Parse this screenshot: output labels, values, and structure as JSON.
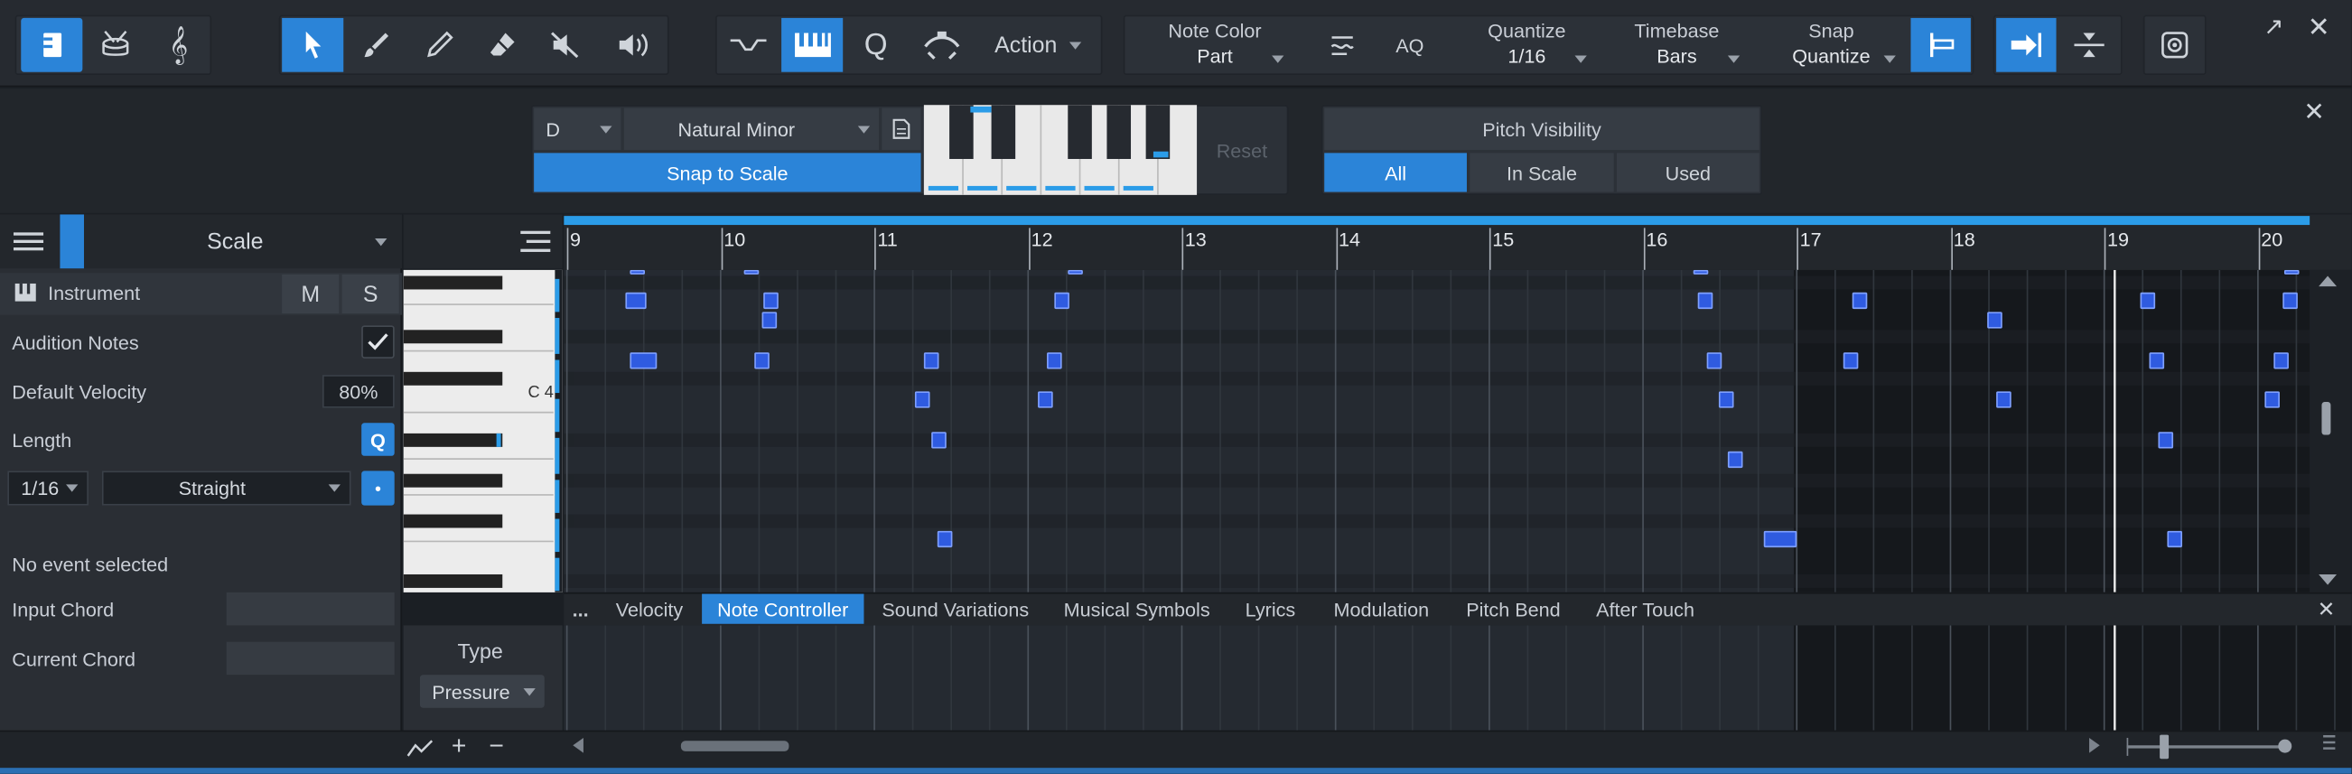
{
  "toolbar": {
    "note_color_label": "Note Color",
    "note_color_value": "Part",
    "aq_label": "AQ",
    "quantize_label": "Quantize",
    "quantize_value": "1/16",
    "timebase_label": "Timebase",
    "timebase_value": "Bars",
    "snap_label": "Snap",
    "snap_value": "Quantize",
    "action_label": "Action"
  },
  "scale_bar": {
    "root": "D",
    "scale": "Natural Minor",
    "snap_to_scale": "Snap to Scale",
    "reset": "Reset",
    "pitch_visibility": "Pitch Visibility",
    "pv_all": "All",
    "pv_in_scale": "In Scale",
    "pv_used": "Used"
  },
  "inspector": {
    "header": "Scale",
    "instrument": "Instrument",
    "m": "M",
    "s": "S",
    "audition_notes": "Audition Notes",
    "default_velocity": "Default Velocity",
    "velocity_value": "80%",
    "length": "Length",
    "q": "Q",
    "length_value": "1/16",
    "length_mode": "Straight",
    "no_event": "No event selected",
    "input_chord": "Input Chord",
    "current_chord": "Current Chord"
  },
  "keyboard": {
    "c4": "C 4"
  },
  "ruler": [
    "9",
    "10",
    "11",
    "12",
    "13",
    "14",
    "15",
    "16",
    "17",
    "18",
    "19",
    "20"
  ],
  "tabs": {
    "more": "...",
    "velocity": "Velocity",
    "note_controller": "Note Controller",
    "sound_variations": "Sound Variations",
    "musical_symbols": "Musical Symbols",
    "lyrics": "Lyrics",
    "modulation": "Modulation",
    "pitch_bend": "Pitch Bend",
    "after_touch": "After Touch"
  },
  "controller": {
    "type_label": "Type",
    "type_value": "Pressure"
  }
}
